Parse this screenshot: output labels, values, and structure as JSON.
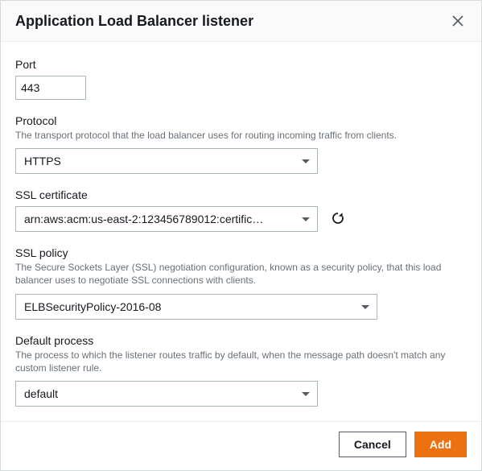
{
  "dialog": {
    "title": "Application Load Balancer listener"
  },
  "port": {
    "label": "Port",
    "value": "443"
  },
  "protocol": {
    "label": "Protocol",
    "help": "The transport protocol that the load balancer uses for routing incoming traffic from clients.",
    "value": "HTTPS"
  },
  "ssl_cert": {
    "label": "SSL certificate",
    "value": "arn:aws:acm:us-east-2:123456789012:certific…"
  },
  "ssl_policy": {
    "label": "SSL policy",
    "help": "The Secure Sockets Layer (SSL) negotiation configuration, known as a security policy, that this load balancer uses to negotiate SSL connections with clients.",
    "value": "ELBSecurityPolicy-2016-08"
  },
  "default_process": {
    "label": "Default process",
    "help": "The process to which the listener routes traffic by default, when the message path doesn't match any custom listener rule.",
    "value": "default"
  },
  "footer": {
    "cancel": "Cancel",
    "add": "Add"
  }
}
